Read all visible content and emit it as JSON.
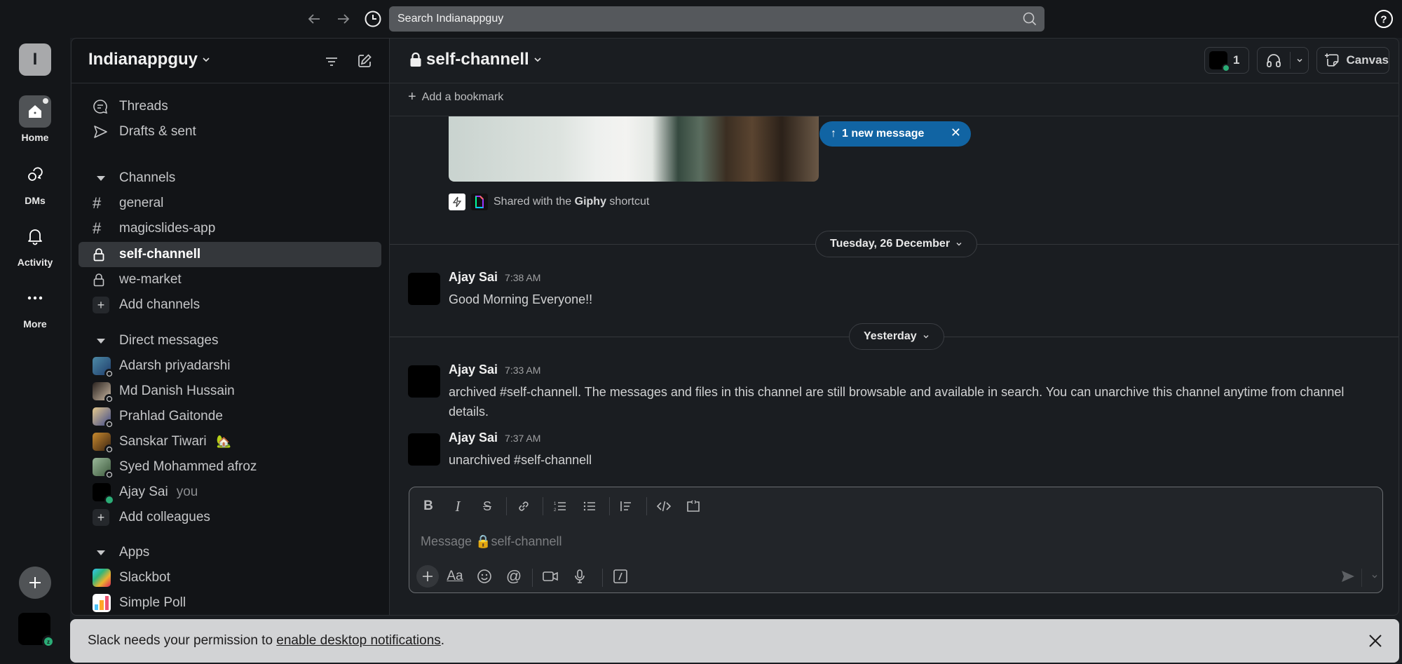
{
  "topbar": {
    "back_icon": "arrow-left-icon",
    "forward_icon": "arrow-right-icon",
    "history_icon": "clock-icon",
    "search_placeholder": "Search Indianappguy",
    "help_icon": "question-circle-icon"
  },
  "rail": {
    "workspace_initial": "I",
    "items": [
      {
        "label": "Home",
        "icon": "home-icon",
        "active": true
      },
      {
        "label": "DMs",
        "icon": "dms-icon"
      },
      {
        "label": "Activity",
        "icon": "bell-icon"
      },
      {
        "label": "More",
        "icon": "more-icon"
      }
    ],
    "add_icon": "plus-icon",
    "user_status": "z"
  },
  "sidebar": {
    "workspace_name": "Indianappguy",
    "top_items": [
      {
        "label": "Threads",
        "icon": "threads-icon"
      },
      {
        "label": "Drafts & sent",
        "icon": "send-icon"
      }
    ],
    "channels_header": "Channels",
    "channels": [
      {
        "label": "general",
        "icon": "hash-icon"
      },
      {
        "label": "magicslides-app",
        "icon": "hash-icon"
      },
      {
        "label": "self-channell",
        "icon": "lock-icon",
        "active": true
      },
      {
        "label": "we-market",
        "icon": "lock-icon"
      }
    ],
    "add_channels": "Add channels",
    "dm_header": "Direct messages",
    "dms": [
      {
        "label": "Adarsh priyadarshi",
        "color": "#3b6f86"
      },
      {
        "label": "Md Danish Hussain",
        "color": "#5a4a3e"
      },
      {
        "label": "Prahlad Gaitonde",
        "color": "#c9a56a"
      },
      {
        "label": "Sanskar Tiwari",
        "color": "#8a5a2a",
        "emoji": "🏡"
      },
      {
        "label": "Syed Mohammed afroz",
        "color": "#6f8b6a"
      },
      {
        "label": "Ajay Sai",
        "color": "#000000",
        "suffix": "you"
      }
    ],
    "add_colleagues": "Add colleagues",
    "apps_header": "Apps",
    "apps": [
      {
        "label": "Slackbot"
      },
      {
        "label": "Simple Poll"
      }
    ]
  },
  "channel": {
    "name": "self-channell",
    "members_count": "1",
    "canvas_label": "Canvas",
    "add_bookmark": "Add a bookmark",
    "new_message_banner": "1 new message",
    "giphy_attribution_pre": "Shared with the ",
    "giphy_attribution_bold": "Giphy",
    "giphy_attribution_post": " shortcut",
    "dates": [
      "Tuesday, 26 December",
      "Yesterday"
    ],
    "messages": [
      {
        "author": "Ajay Sai",
        "time": "7:38 AM",
        "text": "Good Morning Everyone!!"
      },
      {
        "author": "Ajay Sai",
        "time": "7:33 AM",
        "text": "archived #self-channell. The messages and files in this channel are still browsable and available in search. You can unarchive this channel anytime from channel details."
      },
      {
        "author": "Ajay Sai",
        "time": "7:37 AM",
        "text": "unarchived #self-channell"
      }
    ]
  },
  "composer": {
    "placeholder": "Message 🔒self-channell",
    "format_tools": [
      "bold",
      "italic",
      "strikethrough",
      "link",
      "ordered-list",
      "bulleted-list",
      "blockquote",
      "code",
      "code-block"
    ],
    "bottom_tools": [
      "attach",
      "formatting",
      "emoji",
      "mention",
      "video",
      "audio",
      "shortcuts"
    ]
  },
  "notification": {
    "text_pre": "Slack needs your permission to ",
    "link": "enable desktop notifications",
    "text_post": "."
  }
}
